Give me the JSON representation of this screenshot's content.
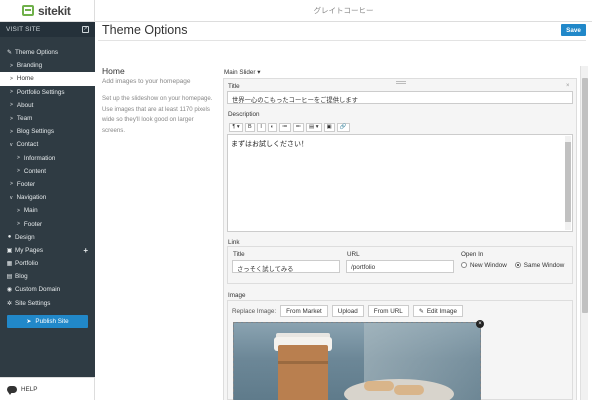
{
  "app": {
    "logo": "sitekit",
    "window_title": "グレイトコーヒー"
  },
  "sidebar": {
    "visit_site": "VISIT SITE",
    "items": [
      {
        "label": "Theme Options",
        "icon": "wrench-icon",
        "level": 0
      },
      {
        "label": "Branding",
        "level": 1,
        "caret": ">"
      },
      {
        "label": "Home",
        "level": 1,
        "caret": ">",
        "active": true
      },
      {
        "label": "Portfolio Settings",
        "level": 1,
        "caret": ">"
      },
      {
        "label": "About",
        "level": 1,
        "caret": ">"
      },
      {
        "label": "Team",
        "level": 1,
        "caret": ">"
      },
      {
        "label": "Blog Settings",
        "level": 1,
        "caret": ">"
      },
      {
        "label": "Contact",
        "level": 1,
        "caret": "v"
      },
      {
        "label": "Information",
        "level": 2,
        "caret": ">"
      },
      {
        "label": "Content",
        "level": 2,
        "caret": ">"
      },
      {
        "label": "Footer",
        "level": 1,
        "caret": ">"
      },
      {
        "label": "Navigation",
        "level": 1,
        "caret": "v"
      },
      {
        "label": "Main",
        "level": 2,
        "caret": ">"
      },
      {
        "label": "Footer",
        "level": 2,
        "caret": ">"
      },
      {
        "label": "Design",
        "icon": "drop-icon",
        "level": 0
      },
      {
        "label": "My Pages",
        "icon": "pages-icon",
        "level": 0,
        "plus": "+"
      },
      {
        "label": "Portfolio",
        "icon": "grid-icon",
        "level": 0
      },
      {
        "label": "Blog",
        "icon": "blog-icon",
        "level": 0
      },
      {
        "label": "Custom Domain",
        "icon": "globe-icon",
        "level": 0
      },
      {
        "label": "Site Settings",
        "icon": "cogs-icon",
        "level": 0
      }
    ],
    "publish_label": "Publish Site",
    "help_label": "HELP"
  },
  "header": {
    "title": "Theme Options",
    "save_label": "Save"
  },
  "section": {
    "title": "Home",
    "subtitle": "Add images to your homepage",
    "description": "Set up the slideshow on your homepage. Use images that are at least 1170 pixels wide so they'll look good on larger screens."
  },
  "slider": {
    "label": "Main Slider ▾",
    "title_label": "Title",
    "title_value": "世界一心のこもったコーヒーをご提供します",
    "description_label": "Description",
    "description_value": "まずはお試しください！",
    "toolbar": [
      "¶ ▾",
      "B",
      "I",
      "◐",
      "≔",
      "≕",
      "▤ ▾",
      "▣",
      "🔗"
    ],
    "link": {
      "label": "Link",
      "title_label": "Title",
      "title_value": "さっそく試してみる",
      "url_label": "URL",
      "url_value": "/portfolio",
      "open_in_label": "Open In",
      "options": [
        "New Window",
        "Same Window"
      ],
      "selected": "Same Window"
    },
    "image": {
      "label": "Image",
      "replace_label": "Replace Image:",
      "buttons": [
        "From Market",
        "Upload",
        "From URL",
        "Edit Image"
      ]
    }
  },
  "colors": {
    "sidebar_bg": "#2f3b43",
    "accent": "#2188c9",
    "brand_green": "#6fb04a"
  }
}
